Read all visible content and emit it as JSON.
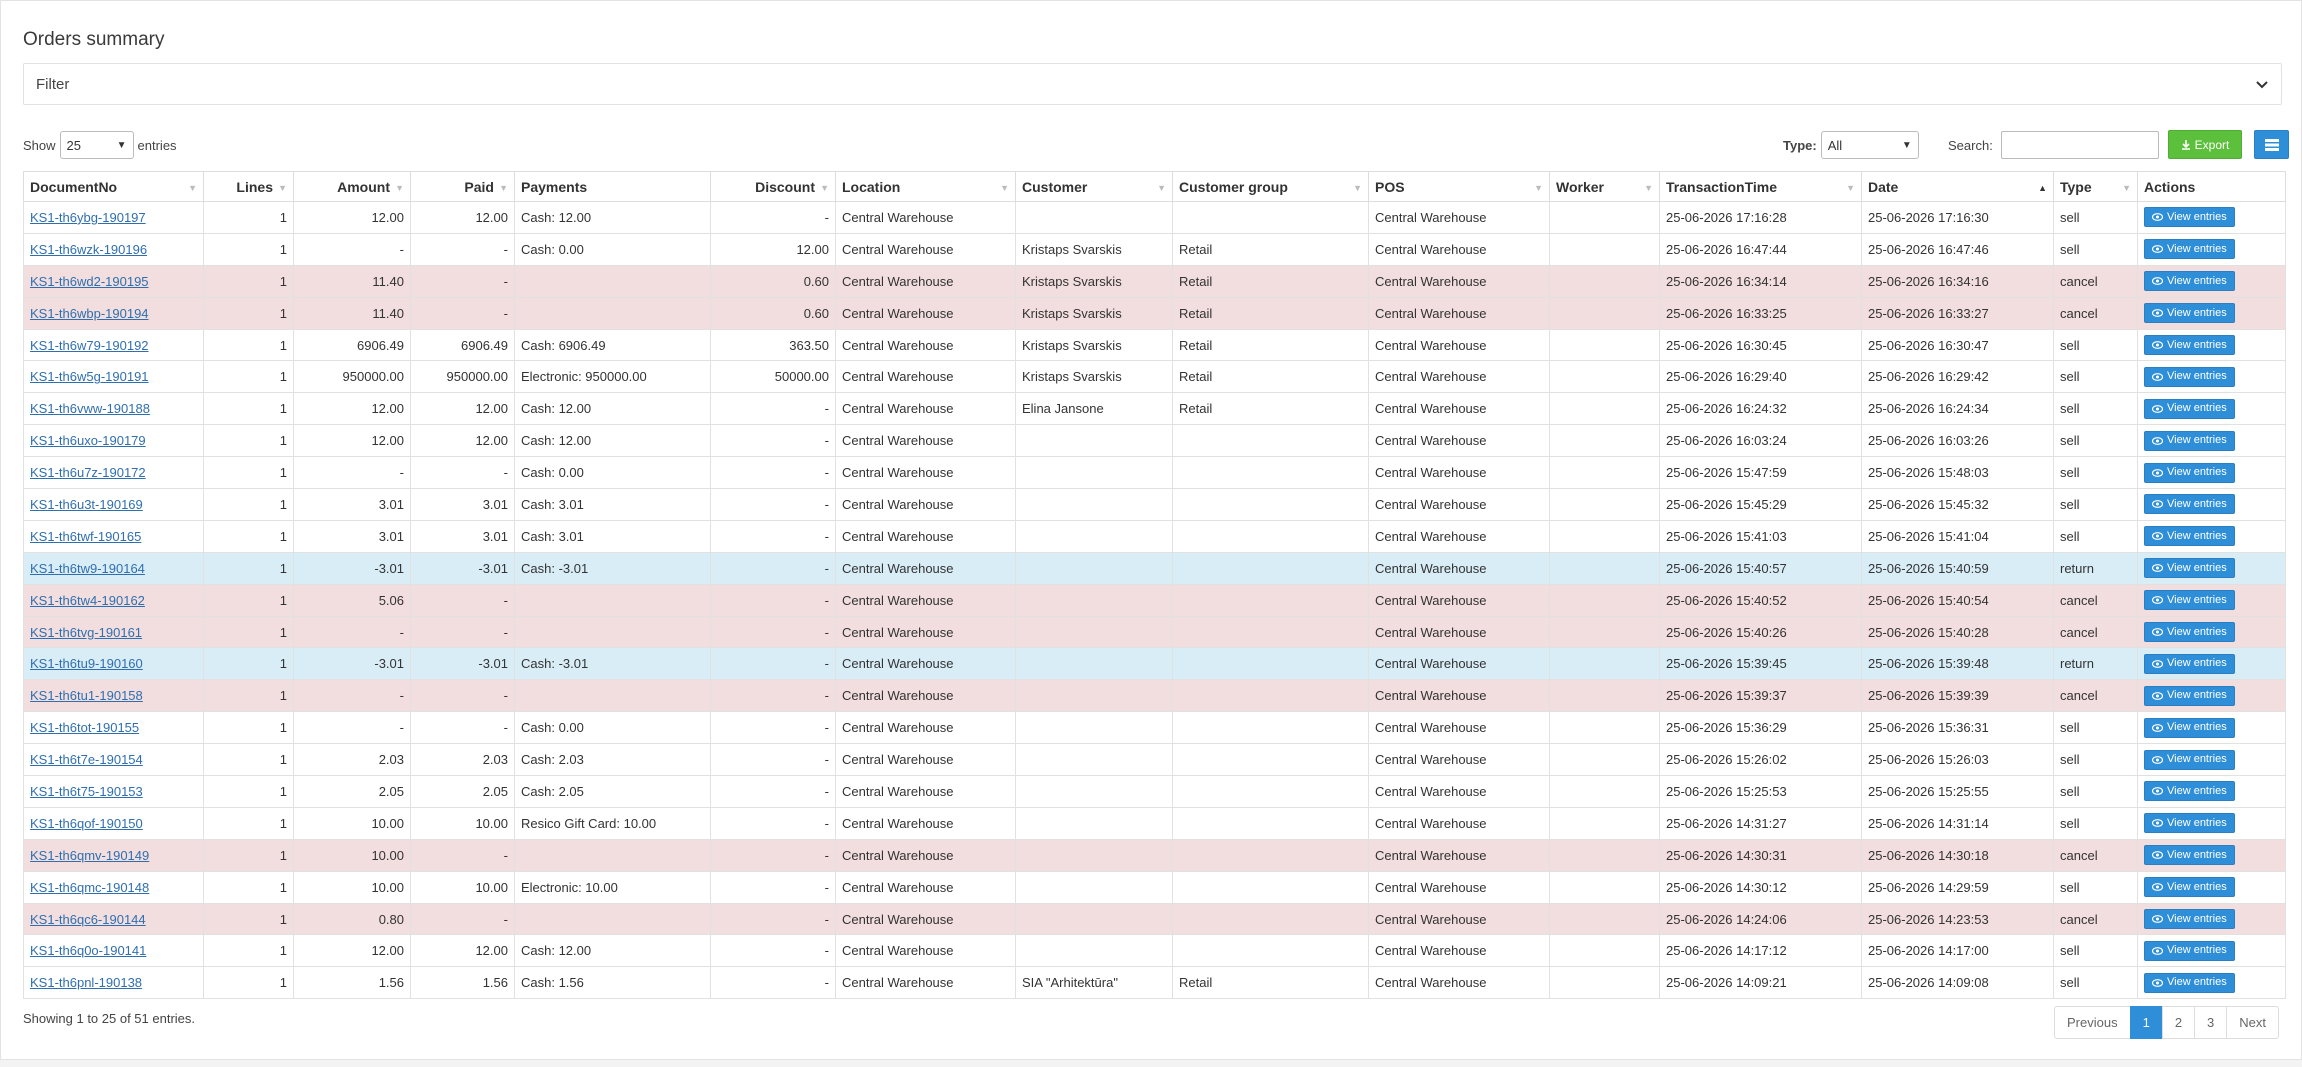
{
  "title": "Orders summary",
  "filter": {
    "label": "Filter"
  },
  "length": {
    "show_label": "Show",
    "value": "25",
    "entries_label": "entries"
  },
  "type_filter": {
    "label": "Type:",
    "value": "All"
  },
  "search": {
    "label": "Search:",
    "value": ""
  },
  "export_label": "Export",
  "columns": [
    "DocumentNo",
    "Lines",
    "Amount",
    "Paid",
    "Payments",
    "Discount",
    "Location",
    "Customer",
    "Customer group",
    "POS",
    "Worker",
    "TransactionTime",
    "Date",
    "Type",
    "Actions"
  ],
  "view_label": "View entries",
  "rows": [
    {
      "doc": "KS1-th6ybg-190197",
      "lines": "1",
      "amount": "12.00",
      "paid": "12.00",
      "payments": "Cash: 12.00",
      "discount": "-",
      "location": "Central Warehouse",
      "customer": "",
      "group": "",
      "pos": "Central Warehouse",
      "worker": "",
      "ttime": "25-06-2026 17:16:28",
      "date": "25-06-2026 17:16:30",
      "type": "sell"
    },
    {
      "doc": "KS1-th6wzk-190196",
      "lines": "1",
      "amount": "-",
      "paid": "-",
      "payments": "Cash: 0.00",
      "discount": "12.00",
      "location": "Central Warehouse",
      "customer": "Kristaps Svarskis",
      "group": "Retail",
      "pos": "Central Warehouse",
      "worker": "",
      "ttime": "25-06-2026 16:47:44",
      "date": "25-06-2026 16:47:46",
      "type": "sell"
    },
    {
      "doc": "KS1-th6wd2-190195",
      "lines": "1",
      "amount": "11.40",
      "paid": "-",
      "payments": "",
      "discount": "0.60",
      "location": "Central Warehouse",
      "customer": "Kristaps Svarskis",
      "group": "Retail",
      "pos": "Central Warehouse",
      "worker": "",
      "ttime": "25-06-2026 16:34:14",
      "date": "25-06-2026 16:34:16",
      "type": "cancel"
    },
    {
      "doc": "KS1-th6wbp-190194",
      "lines": "1",
      "amount": "11.40",
      "paid": "-",
      "payments": "",
      "discount": "0.60",
      "location": "Central Warehouse",
      "customer": "Kristaps Svarskis",
      "group": "Retail",
      "pos": "Central Warehouse",
      "worker": "",
      "ttime": "25-06-2026 16:33:25",
      "date": "25-06-2026 16:33:27",
      "type": "cancel"
    },
    {
      "doc": "KS1-th6w79-190192",
      "lines": "1",
      "amount": "6906.49",
      "paid": "6906.49",
      "payments": "Cash: 6906.49",
      "discount": "363.50",
      "location": "Central Warehouse",
      "customer": "Kristaps Svarskis",
      "group": "Retail",
      "pos": "Central Warehouse",
      "worker": "",
      "ttime": "25-06-2026 16:30:45",
      "date": "25-06-2026 16:30:47",
      "type": "sell"
    },
    {
      "doc": "KS1-th6w5g-190191",
      "lines": "1",
      "amount": "950000.00",
      "paid": "950000.00",
      "payments": "Electronic: 950000.00",
      "discount": "50000.00",
      "location": "Central Warehouse",
      "customer": "Kristaps Svarskis",
      "group": "Retail",
      "pos": "Central Warehouse",
      "worker": "",
      "ttime": "25-06-2026 16:29:40",
      "date": "25-06-2026 16:29:42",
      "type": "sell"
    },
    {
      "doc": "KS1-th6vww-190188",
      "lines": "1",
      "amount": "12.00",
      "paid": "12.00",
      "payments": "Cash: 12.00",
      "discount": "-",
      "location": "Central Warehouse",
      "customer": "Elina Jansone",
      "group": "Retail",
      "pos": "Central Warehouse",
      "worker": "",
      "ttime": "25-06-2026 16:24:32",
      "date": "25-06-2026 16:24:34",
      "type": "sell"
    },
    {
      "doc": "KS1-th6uxo-190179",
      "lines": "1",
      "amount": "12.00",
      "paid": "12.00",
      "payments": "Cash: 12.00",
      "discount": "-",
      "location": "Central Warehouse",
      "customer": "",
      "group": "",
      "pos": "Central Warehouse",
      "worker": "",
      "ttime": "25-06-2026 16:03:24",
      "date": "25-06-2026 16:03:26",
      "type": "sell"
    },
    {
      "doc": "KS1-th6u7z-190172",
      "lines": "1",
      "amount": "-",
      "paid": "-",
      "payments": "Cash: 0.00",
      "discount": "-",
      "location": "Central Warehouse",
      "customer": "",
      "group": "",
      "pos": "Central Warehouse",
      "worker": "",
      "ttime": "25-06-2026 15:47:59",
      "date": "25-06-2026 15:48:03",
      "type": "sell"
    },
    {
      "doc": "KS1-th6u3t-190169",
      "lines": "1",
      "amount": "3.01",
      "paid": "3.01",
      "payments": "Cash: 3.01",
      "discount": "-",
      "location": "Central Warehouse",
      "customer": "",
      "group": "",
      "pos": "Central Warehouse",
      "worker": "",
      "ttime": "25-06-2026 15:45:29",
      "date": "25-06-2026 15:45:32",
      "type": "sell"
    },
    {
      "doc": "KS1-th6twf-190165",
      "lines": "1",
      "amount": "3.01",
      "paid": "3.01",
      "payments": "Cash: 3.01",
      "discount": "-",
      "location": "Central Warehouse",
      "customer": "",
      "group": "",
      "pos": "Central Warehouse",
      "worker": "",
      "ttime": "25-06-2026 15:41:03",
      "date": "25-06-2026 15:41:04",
      "type": "sell"
    },
    {
      "doc": "KS1-th6tw9-190164",
      "lines": "1",
      "amount": "-3.01",
      "paid": "-3.01",
      "payments": "Cash: -3.01",
      "discount": "-",
      "location": "Central Warehouse",
      "customer": "",
      "group": "",
      "pos": "Central Warehouse",
      "worker": "",
      "ttime": "25-06-2026 15:40:57",
      "date": "25-06-2026 15:40:59",
      "type": "return"
    },
    {
      "doc": "KS1-th6tw4-190162",
      "lines": "1",
      "amount": "5.06",
      "paid": "-",
      "payments": "",
      "discount": "-",
      "location": "Central Warehouse",
      "customer": "",
      "group": "",
      "pos": "Central Warehouse",
      "worker": "",
      "ttime": "25-06-2026 15:40:52",
      "date": "25-06-2026 15:40:54",
      "type": "cancel"
    },
    {
      "doc": "KS1-th6tvg-190161",
      "lines": "1",
      "amount": "-",
      "paid": "-",
      "payments": "",
      "discount": "-",
      "location": "Central Warehouse",
      "customer": "",
      "group": "",
      "pos": "Central Warehouse",
      "worker": "",
      "ttime": "25-06-2026 15:40:26",
      "date": "25-06-2026 15:40:28",
      "type": "cancel"
    },
    {
      "doc": "KS1-th6tu9-190160",
      "lines": "1",
      "amount": "-3.01",
      "paid": "-3.01",
      "payments": "Cash: -3.01",
      "discount": "-",
      "location": "Central Warehouse",
      "customer": "",
      "group": "",
      "pos": "Central Warehouse",
      "worker": "",
      "ttime": "25-06-2026 15:39:45",
      "date": "25-06-2026 15:39:48",
      "type": "return"
    },
    {
      "doc": "KS1-th6tu1-190158",
      "lines": "1",
      "amount": "-",
      "paid": "-",
      "payments": "",
      "discount": "-",
      "location": "Central Warehouse",
      "customer": "",
      "group": "",
      "pos": "Central Warehouse",
      "worker": "",
      "ttime": "25-06-2026 15:39:37",
      "date": "25-06-2026 15:39:39",
      "type": "cancel"
    },
    {
      "doc": "KS1-th6tot-190155",
      "lines": "1",
      "amount": "-",
      "paid": "-",
      "payments": "Cash: 0.00",
      "discount": "-",
      "location": "Central Warehouse",
      "customer": "",
      "group": "",
      "pos": "Central Warehouse",
      "worker": "",
      "ttime": "25-06-2026 15:36:29",
      "date": "25-06-2026 15:36:31",
      "type": "sell"
    },
    {
      "doc": "KS1-th6t7e-190154",
      "lines": "1",
      "amount": "2.03",
      "paid": "2.03",
      "payments": "Cash: 2.03",
      "discount": "-",
      "location": "Central Warehouse",
      "customer": "",
      "group": "",
      "pos": "Central Warehouse",
      "worker": "",
      "ttime": "25-06-2026 15:26:02",
      "date": "25-06-2026 15:26:03",
      "type": "sell"
    },
    {
      "doc": "KS1-th6t75-190153",
      "lines": "1",
      "amount": "2.05",
      "paid": "2.05",
      "payments": "Cash: 2.05",
      "discount": "-",
      "location": "Central Warehouse",
      "customer": "",
      "group": "",
      "pos": "Central Warehouse",
      "worker": "",
      "ttime": "25-06-2026 15:25:53",
      "date": "25-06-2026 15:25:55",
      "type": "sell"
    },
    {
      "doc": "KS1-th6qof-190150",
      "lines": "1",
      "amount": "10.00",
      "paid": "10.00",
      "payments": "Resico Gift Card: 10.00",
      "discount": "-",
      "location": "Central Warehouse",
      "customer": "",
      "group": "",
      "pos": "Central Warehouse",
      "worker": "",
      "ttime": "25-06-2026 14:31:27",
      "date": "25-06-2026 14:31:14",
      "type": "sell"
    },
    {
      "doc": "KS1-th6qmv-190149",
      "lines": "1",
      "amount": "10.00",
      "paid": "-",
      "payments": "",
      "discount": "-",
      "location": "Central Warehouse",
      "customer": "",
      "group": "",
      "pos": "Central Warehouse",
      "worker": "",
      "ttime": "25-06-2026 14:30:31",
      "date": "25-06-2026 14:30:18",
      "type": "cancel"
    },
    {
      "doc": "KS1-th6qmc-190148",
      "lines": "1",
      "amount": "10.00",
      "paid": "10.00",
      "payments": "Electronic: 10.00",
      "discount": "-",
      "location": "Central Warehouse",
      "customer": "",
      "group": "",
      "pos": "Central Warehouse",
      "worker": "",
      "ttime": "25-06-2026 14:30:12",
      "date": "25-06-2026 14:29:59",
      "type": "sell"
    },
    {
      "doc": "KS1-th6qc6-190144",
      "lines": "1",
      "amount": "0.80",
      "paid": "-",
      "payments": "",
      "discount": "-",
      "location": "Central Warehouse",
      "customer": "",
      "group": "",
      "pos": "Central Warehouse",
      "worker": "",
      "ttime": "25-06-2026 14:24:06",
      "date": "25-06-2026 14:23:53",
      "type": "cancel"
    },
    {
      "doc": "KS1-th6q0o-190141",
      "lines": "1",
      "amount": "12.00",
      "paid": "12.00",
      "payments": "Cash: 12.00",
      "discount": "-",
      "location": "Central Warehouse",
      "customer": "",
      "group": "",
      "pos": "Central Warehouse",
      "worker": "",
      "ttime": "25-06-2026 14:17:12",
      "date": "25-06-2026 14:17:00",
      "type": "sell"
    },
    {
      "doc": "KS1-th6pnl-190138",
      "lines": "1",
      "amount": "1.56",
      "paid": "1.56",
      "payments": "Cash: 1.56",
      "discount": "-",
      "location": "Central Warehouse",
      "customer": "SIA \"Arhitektūra\"",
      "group": "Retail",
      "pos": "Central Warehouse",
      "worker": "",
      "ttime": "25-06-2026 14:09:21",
      "date": "25-06-2026 14:09:08",
      "type": "sell"
    }
  ],
  "info": "Showing 1 to 25 of 51 entries.",
  "pagination": {
    "previous": "Previous",
    "pages": [
      "1",
      "2",
      "3"
    ],
    "current": "1",
    "next": "Next"
  },
  "colors": {
    "cancel_row": "#f2dede",
    "return_row": "#d9edf7",
    "primary": "#2e8fd8",
    "export": "#5cc03c"
  },
  "icons": {
    "export": "download-icon",
    "view": "eye-icon",
    "columns": "list-icon",
    "filter_toggle": "chevron-down-icon"
  }
}
